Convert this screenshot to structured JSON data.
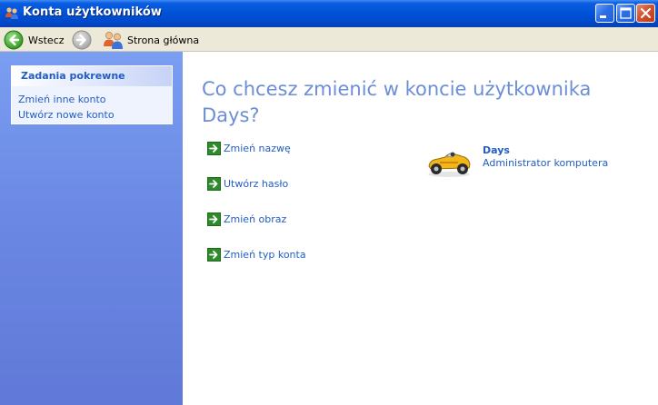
{
  "window": {
    "title": "Konta użytkowników",
    "icon": "users-icon",
    "controls": [
      "minimize-icon",
      "maximize-icon",
      "close-icon"
    ]
  },
  "toolbar": {
    "back_label": "Wstecz",
    "back_icon": "back-arrow-icon",
    "forward_icon": "forward-arrow-icon",
    "home_label": "Strona główna",
    "home_icon": "users-home-icon"
  },
  "sidebar": {
    "panel_title": "Zadania pokrewne",
    "links": [
      {
        "label": "Zmień inne konto"
      },
      {
        "label": "Utwórz nowe konto"
      }
    ]
  },
  "main": {
    "heading": "Co chcesz zmienić w koncie użytkownika Days?",
    "tasks": [
      {
        "label": "Zmień nazwę",
        "icon": "green-arrow-icon"
      },
      {
        "label": "Utwórz hasło",
        "icon": "green-arrow-icon"
      },
      {
        "label": "Zmień obraz",
        "icon": "green-arrow-icon"
      },
      {
        "label": "Zmień typ konta",
        "icon": "green-arrow-icon"
      }
    ],
    "user": {
      "name": "Days",
      "role": "Administrator komputera",
      "picture": "race-car-icon"
    }
  },
  "colors": {
    "titlebar": "#0052d8",
    "sidebar": "#6a87e3",
    "link": "#215dc6",
    "heading": "#6c8ed6",
    "toolbar": "#ece9d8"
  }
}
